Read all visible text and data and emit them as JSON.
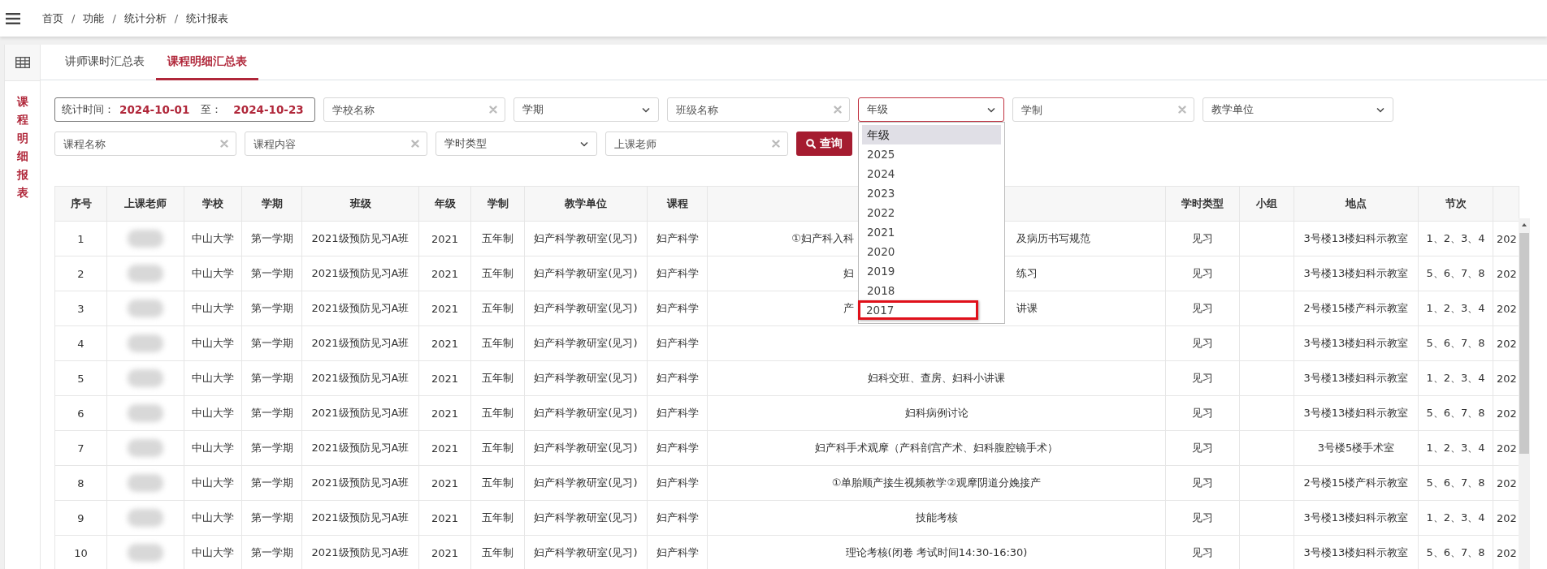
{
  "breadcrumb": {
    "separator": "/",
    "items": [
      "首页",
      "功能",
      "统计分析",
      "统计报表"
    ]
  },
  "side_label": "课程明细报表",
  "tabs": [
    {
      "label": "讲师课时汇总表",
      "selected": false
    },
    {
      "label": "课程明细汇总表",
      "selected": true
    }
  ],
  "filters": [
    {
      "kind": "date_range",
      "label": "统计时间：",
      "start": "2024-10-01",
      "separator": "至：",
      "end": "2024-10-23"
    },
    {
      "kind": "text",
      "placeholder": "学校名称"
    },
    {
      "kind": "select",
      "value": "学期",
      "open": false
    },
    {
      "kind": "text",
      "placeholder": "班级名称"
    },
    {
      "kind": "select",
      "value": "年级",
      "open": true,
      "options": [
        {
          "label": "年级",
          "selected": true,
          "outlined": false
        },
        {
          "label": "2025",
          "selected": false,
          "outlined": false
        },
        {
          "label": "2024",
          "selected": false,
          "outlined": false
        },
        {
          "label": "2023",
          "selected": false,
          "outlined": false
        },
        {
          "label": "2022",
          "selected": false,
          "outlined": false
        },
        {
          "label": "2021",
          "selected": false,
          "outlined": false
        },
        {
          "label": "2020",
          "selected": false,
          "outlined": false
        },
        {
          "label": "2019",
          "selected": false,
          "outlined": false
        },
        {
          "label": "2018",
          "selected": false,
          "outlined": false
        },
        {
          "label": "2017",
          "selected": false,
          "outlined": true
        }
      ]
    },
    {
      "kind": "text",
      "placeholder": "学制"
    },
    {
      "kind": "select",
      "value": "教学单位",
      "open": false
    },
    {
      "kind": "text",
      "placeholder": "课程名称"
    },
    {
      "kind": "text",
      "placeholder": "课程内容"
    },
    {
      "kind": "select",
      "value": "学时类型",
      "open": false
    },
    {
      "kind": "text",
      "placeholder": "上课老师"
    },
    {
      "kind": "button",
      "label": "查询"
    }
  ],
  "table": {
    "columns": [
      "序号",
      "上课老师",
      "学校",
      "学期",
      "班级",
      "年级",
      "学制",
      "教学单位",
      "课程",
      "",
      "学时类型",
      "小组",
      "地点",
      "节次"
    ],
    "rows": [
      {
        "no": "1",
        "teacher_blurred": true,
        "school": "中山大学",
        "term": "第一学期",
        "class": "2021级预防见习A班",
        "grade": "2021",
        "system": "五年制",
        "unit": "妇产科学教研室(见习)",
        "course": "妇产科学",
        "content": [
          "①妇产科入科",
          "及病历书写规范"
        ],
        "hour_type": "见习",
        "group": "",
        "place": "3号楼13楼妇科示教室",
        "periods": "1、2、3、4",
        "column_15": "202"
      },
      {
        "no": "2",
        "teacher_blurred": true,
        "school": "中山大学",
        "term": "第一学期",
        "class": "2021级预防见习A班",
        "grade": "2021",
        "system": "五年制",
        "unit": "妇产科学教研室(见习)",
        "course": "妇产科学",
        "content": [
          "妇",
          "练习"
        ],
        "hour_type": "见习",
        "group": "",
        "place": "3号楼13楼妇科示教室",
        "periods": "5、6、7、8",
        "column_15": "202"
      },
      {
        "no": "3",
        "teacher_blurred": true,
        "school": "中山大学",
        "term": "第一学期",
        "class": "2021级预防见习A班",
        "grade": "2021",
        "system": "五年制",
        "unit": "妇产科学教研室(见习)",
        "course": "妇产科学",
        "content": [
          "产",
          "讲课"
        ],
        "hour_type": "见习",
        "group": "",
        "place": "2号楼15楼产科示教室",
        "periods": "1、2、3、4",
        "column_15": "202"
      },
      {
        "no": "4",
        "teacher_blurred": true,
        "school": "中山大学",
        "term": "第一学期",
        "class": "2021级预防见习A班",
        "grade": "2021",
        "system": "五年制",
        "unit": "妇产科学教研室(见习)",
        "course": "妇产科学",
        "content": [],
        "hour_type": "见习",
        "group": "",
        "place": "3号楼13楼妇科示教室",
        "periods": "5、6、7、8",
        "column_15": "202"
      },
      {
        "no": "5",
        "teacher_blurred": true,
        "school": "中山大学",
        "term": "第一学期",
        "class": "2021级预防见习A班",
        "grade": "2021",
        "system": "五年制",
        "unit": "妇产科学教研室(见习)",
        "course": "妇产科学",
        "content": [
          "妇科交班、查房、妇科小讲课"
        ],
        "hour_type": "见习",
        "group": "",
        "place": "3号楼13楼妇科示教室",
        "periods": "1、2、3、4",
        "column_15": "202"
      },
      {
        "no": "6",
        "teacher_blurred": true,
        "school": "中山大学",
        "term": "第一学期",
        "class": "2021级预防见习A班",
        "grade": "2021",
        "system": "五年制",
        "unit": "妇产科学教研室(见习)",
        "course": "妇产科学",
        "content": [
          "妇科病例讨论"
        ],
        "hour_type": "见习",
        "group": "",
        "place": "3号楼13楼妇科示教室",
        "periods": "5、6、7、8",
        "column_15": "202"
      },
      {
        "no": "7",
        "teacher_blurred": true,
        "school": "中山大学",
        "term": "第一学期",
        "class": "2021级预防见习A班",
        "grade": "2021",
        "system": "五年制",
        "unit": "妇产科学教研室(见习)",
        "course": "妇产科学",
        "content": [
          "妇产科手术观摩（产科剖宫产术、妇科腹腔镜手术）"
        ],
        "hour_type": "见习",
        "group": "",
        "place": "3号楼5楼手术室",
        "periods": "1、2、3、4",
        "column_15": "202"
      },
      {
        "no": "8",
        "teacher_blurred": true,
        "school": "中山大学",
        "term": "第一学期",
        "class": "2021级预防见习A班",
        "grade": "2021",
        "system": "五年制",
        "unit": "妇产科学教研室(见习)",
        "course": "妇产科学",
        "content": [
          "①单胎顺产接生视频教学②观摩阴道分娩接产"
        ],
        "hour_type": "见习",
        "group": "",
        "place": "2号楼15楼产科示教室",
        "periods": "5、6、7、8",
        "column_15": "202"
      },
      {
        "no": "9",
        "teacher_blurred": true,
        "school": "中山大学",
        "term": "第一学期",
        "class": "2021级预防见习A班",
        "grade": "2021",
        "system": "五年制",
        "unit": "妇产科学教研室(见习)",
        "course": "妇产科学",
        "content": [
          "技能考核"
        ],
        "hour_type": "见习",
        "group": "",
        "place": "3号楼13楼妇科示教室",
        "periods": "1、2、3、4",
        "column_15": "202"
      },
      {
        "no": "10",
        "teacher_blurred": true,
        "school": "中山大学",
        "term": "第一学期",
        "class": "2021级预防见习A班",
        "grade": "2021",
        "system": "五年制",
        "unit": "妇产科学教研室(见习)",
        "course": "妇产科学",
        "content": [
          "理论考核(闭卷 考试时间14:30-16:30)"
        ],
        "hour_type": "见习",
        "group": "",
        "place": "3号楼13楼妇科示教室",
        "periods": "5、6、7、8",
        "column_15": "202"
      }
    ]
  }
}
